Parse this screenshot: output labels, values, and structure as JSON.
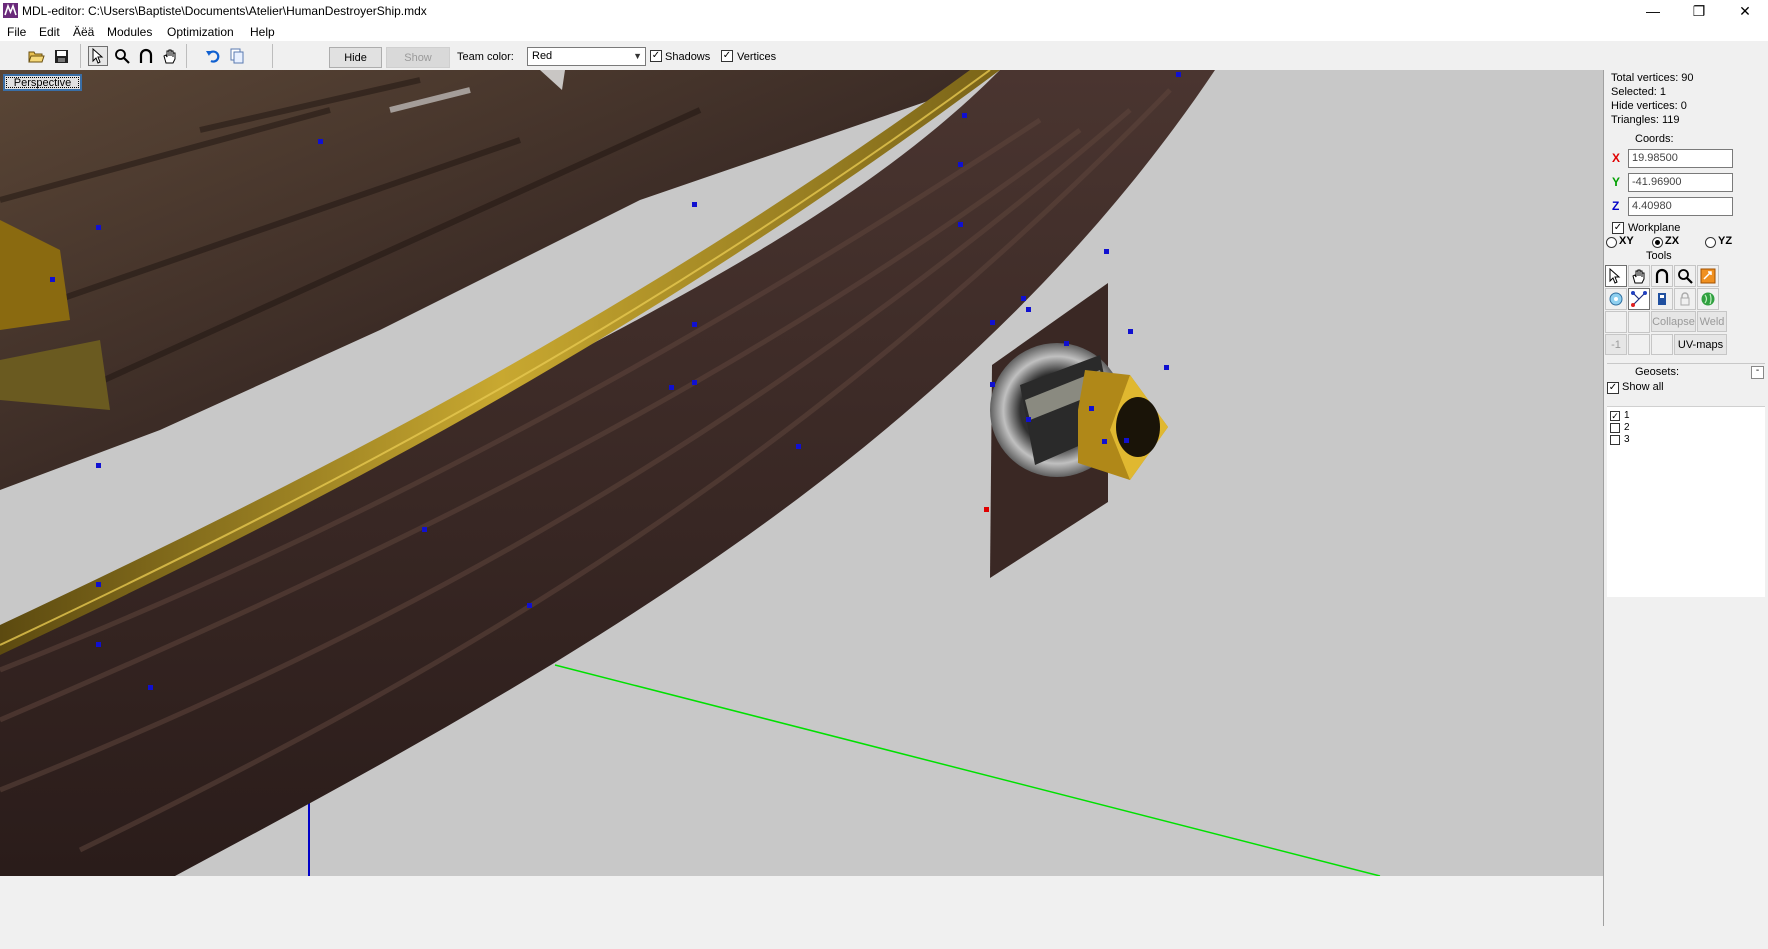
{
  "window": {
    "title": "MDL-editor: C:\\Users\\Baptiste\\Documents\\Atelier\\HumanDestroyerShip.mdx",
    "minimize_glyph": "—",
    "maximize_glyph": "❐",
    "close_glyph": "✕"
  },
  "menu": [
    "File",
    "Edit",
    "Äëä",
    "Modules",
    "Optimization",
    "Help"
  ],
  "toolbar": {
    "hide_label": "Hide",
    "show_label": "Show",
    "team_color_label": "Team color:",
    "team_color_value": "Red",
    "shadows_label": "Shadows",
    "shadows_checked": true,
    "vertices_label": "Vertices",
    "vertices_checked": true
  },
  "viewport": {
    "view_label": "Perspective"
  },
  "panel": {
    "total_vertices": "Total vertices: 90",
    "selected": "Selected: 1",
    "hide_vertices": "Hide vertices: 0",
    "triangles": "Triangles: 119",
    "coords_label": "Coords:",
    "x_label": "X",
    "x_value": "19.98500",
    "y_label": "Y",
    "y_value": "-41.96900",
    "z_label": "Z",
    "z_value": "4.40980",
    "workplane_label": "Workplane",
    "plane_xy": "XY",
    "plane_zx": "ZX",
    "plane_yz": "YZ",
    "plane_selected": "ZX",
    "tools_label": "Tools",
    "collapse_label": "Collapse",
    "weld_label": "Weld",
    "minus_one_label": "-1",
    "uvmaps_label": "UV-maps",
    "geosets_label": "Geosets:",
    "geosets_collapse": "-",
    "show_all_label": "Show all",
    "geosets": [
      {
        "label": "1",
        "checked": true
      },
      {
        "label": "2",
        "checked": false
      },
      {
        "label": "3",
        "checked": false
      }
    ]
  },
  "colors": {
    "accent_red": "#e00000",
    "axis_green": "#00e000",
    "axis_blue": "#0000c8",
    "vertex_blue": "#1010d0",
    "hull_dark": "#3a2a24",
    "gold_trim": "#b89018"
  }
}
